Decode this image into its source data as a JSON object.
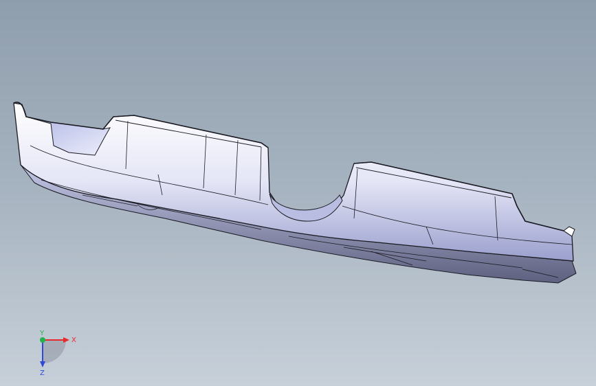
{
  "viewport": {
    "background_top": "#8f9ead",
    "background_bottom": "#c7d0d9"
  },
  "model": {
    "part": "bumper-diffuser",
    "face_color": "#f7f7fd",
    "shade_color": "#9ea3cf",
    "edge_color": "#1a1a22"
  },
  "triad": {
    "x_label": "X",
    "y_label": "Y",
    "z_label": "Z",
    "x_color": "#e8292b",
    "y_color": "#22b14c",
    "z_color": "#2f48d8"
  }
}
